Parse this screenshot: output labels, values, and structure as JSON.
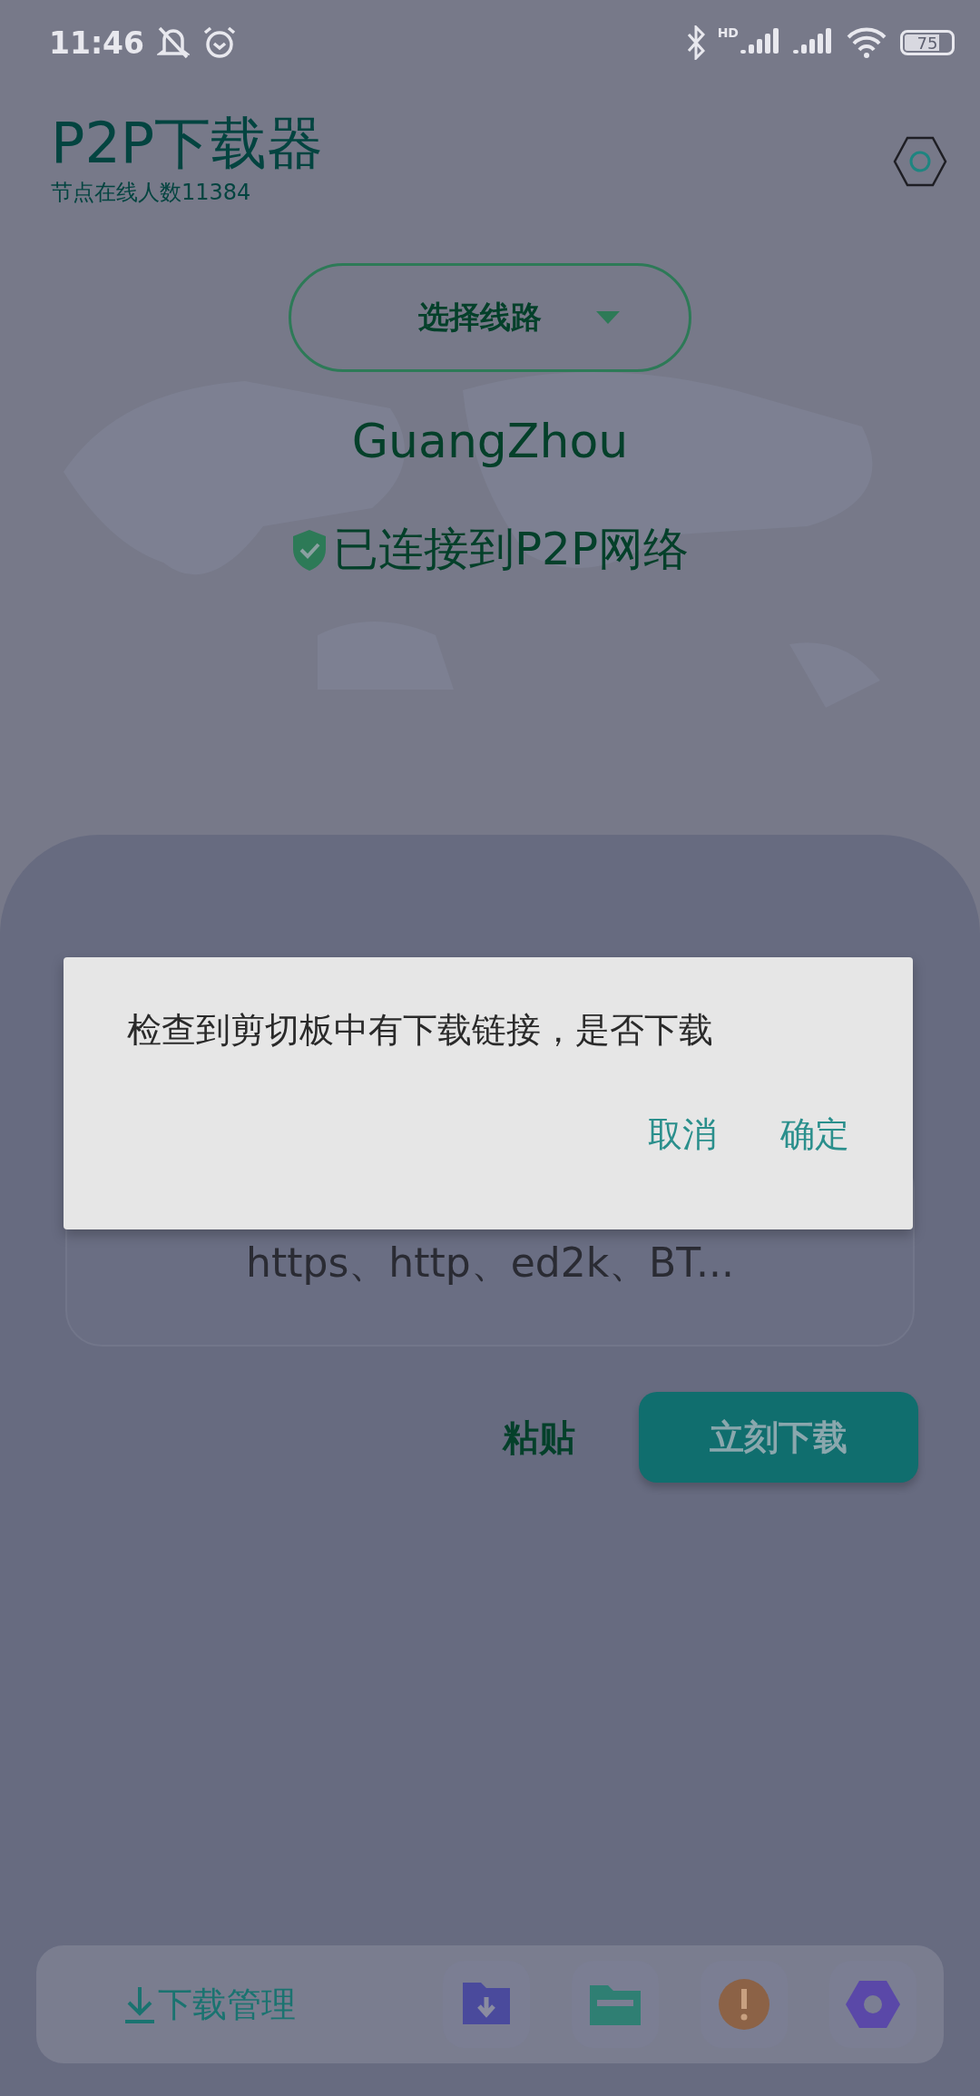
{
  "status_bar": {
    "time": "11:46",
    "network_label": "HD",
    "battery": "75"
  },
  "header": {
    "title": "P2P下载器",
    "subtitle": "节点在线人数11384"
  },
  "route_selector": {
    "label": "选择线路"
  },
  "location": "GuangZhou",
  "connection_status": {
    "text": "已连接到P2P网络",
    "connected": true
  },
  "link_card": {
    "placeholder": "https、http、ed2k、BT...",
    "paste_button": "粘贴",
    "download_button": "立刻下载"
  },
  "bottom_bar": {
    "manager_label": "下载管理",
    "shortcuts": [
      {
        "kind": "download-folder",
        "color": "#4a4a9c"
      },
      {
        "kind": "folder",
        "color": "#2f7f73"
      },
      {
        "kind": "alert",
        "color": "#8c6246"
      },
      {
        "kind": "settings",
        "color": "#5a48a8"
      }
    ]
  },
  "dialog": {
    "message": "检查到剪切板中有下载链接，是否下载",
    "buttons": [
      {
        "label": "取消"
      },
      {
        "label": "确定"
      }
    ]
  }
}
